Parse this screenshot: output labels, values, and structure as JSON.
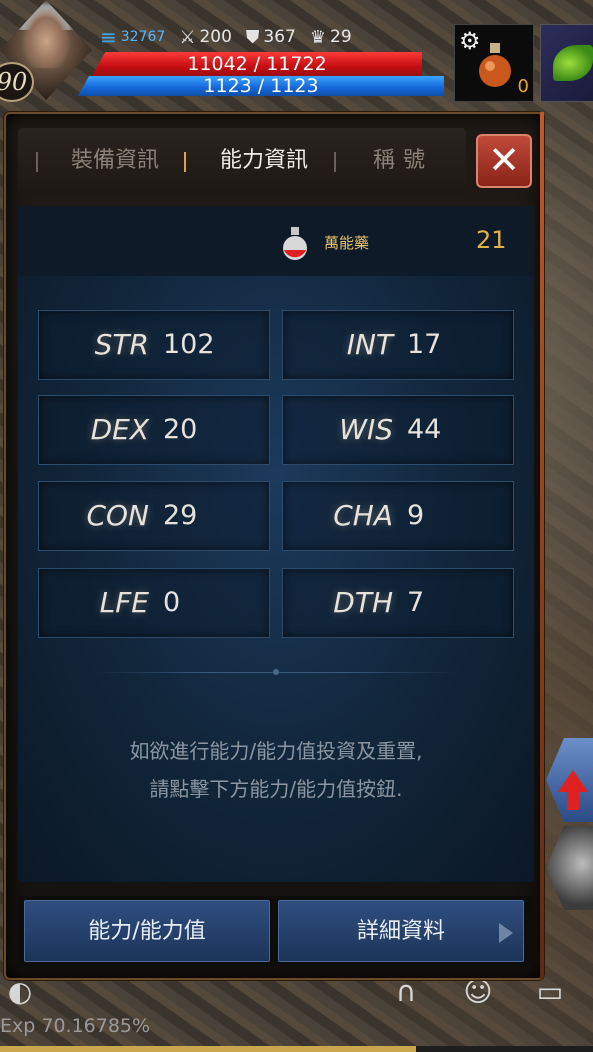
{
  "hud": {
    "level": "90",
    "speed": "32767",
    "stat_attack": "200",
    "stat_defense": "367",
    "stat_trophy": "29",
    "hp": "11042 / 11722",
    "mp": "1123 / 1123",
    "slot_potion_count": "0"
  },
  "tabs": {
    "equip": "裝備資訊",
    "ability": "能力資訊",
    "title": "稱號"
  },
  "close_label": "✕",
  "potion": {
    "name": "萬能藥",
    "count": "21"
  },
  "stats": [
    {
      "name": "STR",
      "value": "102"
    },
    {
      "name": "INT",
      "value": "17"
    },
    {
      "name": "DEX",
      "value": "20"
    },
    {
      "name": "WIS",
      "value": "44"
    },
    {
      "name": "CON",
      "value": "29"
    },
    {
      "name": "CHA",
      "value": "9"
    },
    {
      "name": "LFE",
      "value": "0"
    },
    {
      "name": "DTH",
      "value": "7"
    }
  ],
  "hint": {
    "line1": "如欲進行能力/能力值投資及重置,",
    "line2": "請點擊下方能力/能力值按鈕."
  },
  "buttons": {
    "ability": "能力/能力值",
    "detail": "詳細資料"
  },
  "exp": {
    "text": "Exp 70.16785%",
    "fraction": 0.7016785
  }
}
